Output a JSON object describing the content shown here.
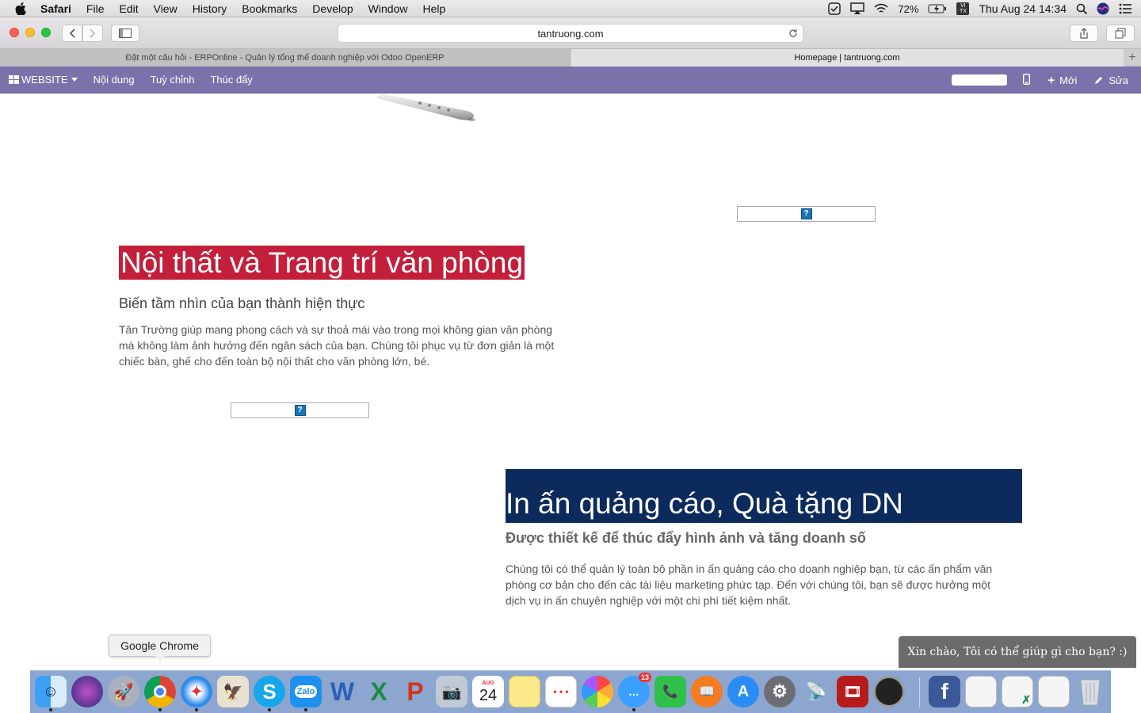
{
  "menubar": {
    "app_name": "Safari",
    "menus": [
      "File",
      "Edit",
      "View",
      "History",
      "Bookmarks",
      "Develop",
      "Window",
      "Help"
    ],
    "battery": "72%",
    "input_method": "VI TX",
    "datetime": "Thu Aug 24  14:34"
  },
  "browser": {
    "url": "tantruong.com",
    "tabs": [
      {
        "title": "Đặt một câu hỏi - ERPOnline - Quản lý tổng thể doanh nghiệp với Odoo OpenERP",
        "active": false
      },
      {
        "title": "Homepage | tantruong.com",
        "active": true
      }
    ]
  },
  "odoo_bar": {
    "website_label": "WEBSITE",
    "menu_items": [
      "Nội dung",
      "Tuỳ chỉnh",
      "Thúc đẩy"
    ],
    "new_label": "Mới",
    "edit_label": "Sửa"
  },
  "page": {
    "section1": {
      "title": "Nội thất và Trang trí văn phòng",
      "subtitle": "Biến tầm nhìn của bạn thành hiện thực",
      "body": "Tân Trường giúp mang phong cách và sự thoả mái vào trong mọi không gian văn phòng mà không làm ảnh hưởng đến ngân sách của bạn. Chúng tôi phục vụ từ đơn giản là một chiếc bàn, ghế cho đến toàn bộ nội thất cho văn phòng lớn, bé."
    },
    "section2": {
      "title": "In ấn quảng cáo, Quà tặng DN",
      "subtitle": "Được thiết kế để thúc đẩy hình ảnh và tăng doanh số",
      "body": "Chúng tôi có thể quản lý toàn bộ phần in ấn quảng cáo cho doanh nghiệp bạn, từ các ấn phẩm văn phòng cơ bản cho đến các tài liệu marketing phức tạp. Đến với chúng tôi, bạn sẽ được hưởng một dịch vụ in ấn chuyên nghiệp với một chi phí tiết kiệm nhất."
    },
    "missing_image_glyph": "?"
  },
  "chat_widget": "Xin chào, Tôi có thể giúp gì cho bạn? :)",
  "dock": {
    "tooltip": "Google Chrome",
    "calendar_month": "AUG",
    "calendar_day": "24",
    "messages_badge": "13",
    "apps": [
      "finder",
      "siri",
      "launchpad",
      "chrome",
      "safari",
      "preview-photo",
      "skype",
      "zalo",
      "word",
      "excel",
      "powerpoint",
      "image-capture",
      "calendar",
      "notes",
      "reminders",
      "photos",
      "messages",
      "facetime",
      "ibooks",
      "app-store",
      "system-preferences",
      "network-utility",
      "photo-booth",
      "screenshot",
      "facebook",
      "window-1",
      "window-2",
      "window-3",
      "trash"
    ]
  },
  "colors": {
    "odoo_purple": "#7c72ab",
    "red_banner": "#c31f3a",
    "navy_banner": "#0c2a5c"
  }
}
